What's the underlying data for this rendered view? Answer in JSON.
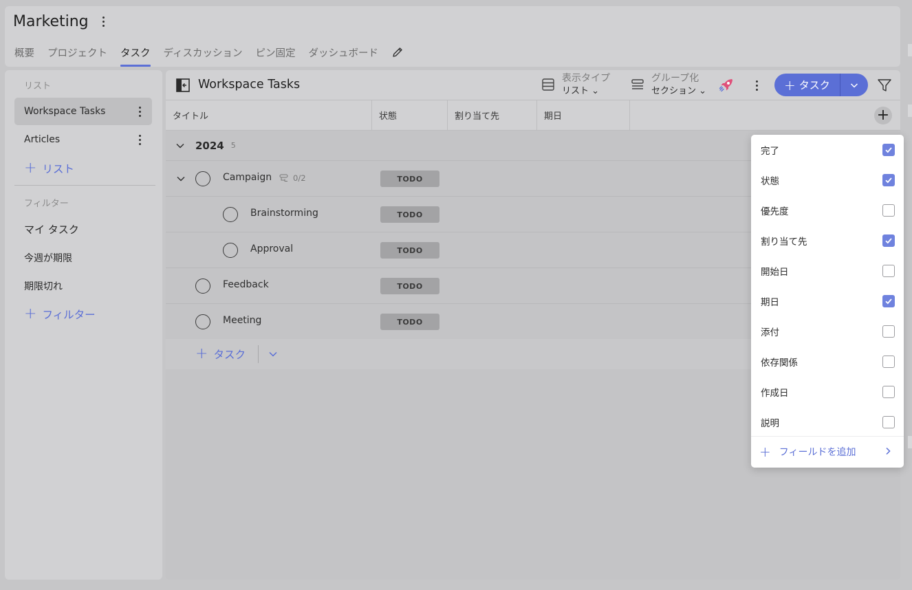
{
  "workspace": {
    "title": "Marketing"
  },
  "tabs": [
    {
      "label": "概要"
    },
    {
      "label": "プロジェクト"
    },
    {
      "label": "タスク"
    },
    {
      "label": "ディスカッション"
    },
    {
      "label": "ピン固定"
    },
    {
      "label": "ダッシュボード"
    }
  ],
  "sidebar": {
    "lists_label": "リスト",
    "lists": [
      {
        "label": "Workspace Tasks"
      },
      {
        "label": "Articles"
      }
    ],
    "add_list": "リスト",
    "filters_label": "フィルター",
    "filters": [
      {
        "label": "マイ タスク"
      },
      {
        "label": "今週が期限"
      },
      {
        "label": "期限切れ"
      }
    ],
    "add_filter": "フィルター"
  },
  "main": {
    "title": "Workspace Tasks",
    "view_type_label": "表示タイプ",
    "view_type_value": "リスト",
    "group_by_label": "グループ化",
    "group_by_value": "セクション",
    "add_task_label": "タスク",
    "columns": [
      {
        "label": "タイトル"
      },
      {
        "label": "状態"
      },
      {
        "label": "割り当て先"
      },
      {
        "label": "期日"
      }
    ],
    "group": {
      "name": "2024",
      "count": "5"
    },
    "tasks": [
      {
        "name": "Campaign",
        "status": "TODO",
        "subtasks": "0/2"
      },
      {
        "name": "Brainstorming",
        "status": "TODO"
      },
      {
        "name": "Approval",
        "status": "TODO"
      },
      {
        "name": "Feedback",
        "status": "TODO"
      },
      {
        "name": "Meeting",
        "status": "TODO"
      }
    ],
    "add_task_row_label": "タスク"
  },
  "field_menu": {
    "items": [
      {
        "label": "完了",
        "checked": true
      },
      {
        "label": "状態",
        "checked": true
      },
      {
        "label": "優先度",
        "checked": false
      },
      {
        "label": "割り当て先",
        "checked": true
      },
      {
        "label": "開始日",
        "checked": false
      },
      {
        "label": "期日",
        "checked": true
      },
      {
        "label": "添付",
        "checked": false
      },
      {
        "label": "依存関係",
        "checked": false
      },
      {
        "label": "作成日",
        "checked": false
      },
      {
        "label": "説明",
        "checked": false
      }
    ],
    "add_field_label": "フィールドを追加"
  },
  "colors": {
    "accent": "#5b6fd6",
    "checkbox_on": "#6f82de",
    "status_pill": "#a3a3a5"
  }
}
